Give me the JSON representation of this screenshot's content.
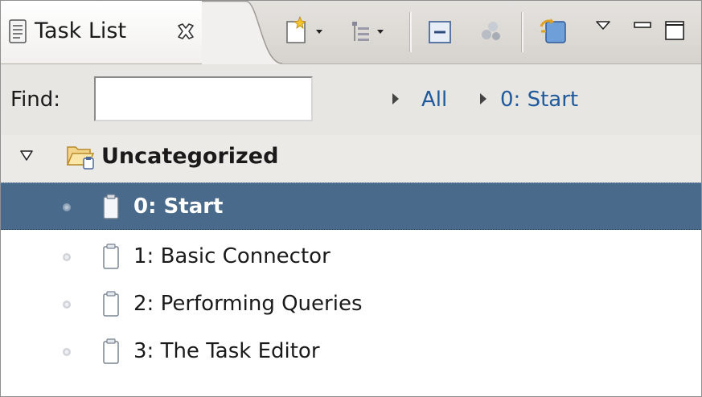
{
  "view": {
    "title": "Task List",
    "tab_icon": "task-list-view-icon",
    "close_icon": "close-icon"
  },
  "toolbar": {
    "buttons": [
      {
        "icon": "new-task-dropdown-icon"
      },
      {
        "icon": "presentation-dropdown-icon"
      },
      {
        "icon": "collapse-all-icon"
      },
      {
        "icon": "focus-on-workweek-icon"
      },
      {
        "icon": "synchronize-icon"
      },
      {
        "icon": "view-menu-icon"
      },
      {
        "icon": "minimize-icon"
      },
      {
        "icon": "maximize-icon"
      }
    ]
  },
  "find": {
    "label": "Find:",
    "value": ""
  },
  "breadcrumb": {
    "items": [
      "All",
      "0: Start"
    ]
  },
  "tree": {
    "category": {
      "label": "Uncategorized",
      "expanded": true
    },
    "tasks": [
      {
        "label": "0: Start",
        "selected": true
      },
      {
        "label": "1: Basic Connector",
        "selected": false
      },
      {
        "label": "2: Performing Queries",
        "selected": false
      },
      {
        "label": "3: The Task Editor",
        "selected": false
      }
    ]
  },
  "colors": {
    "selection": "#4a6a8c",
    "link": "#1e5a9c",
    "tab_bar": "#dcd9d4",
    "find_bar": "#e8e6e2"
  }
}
